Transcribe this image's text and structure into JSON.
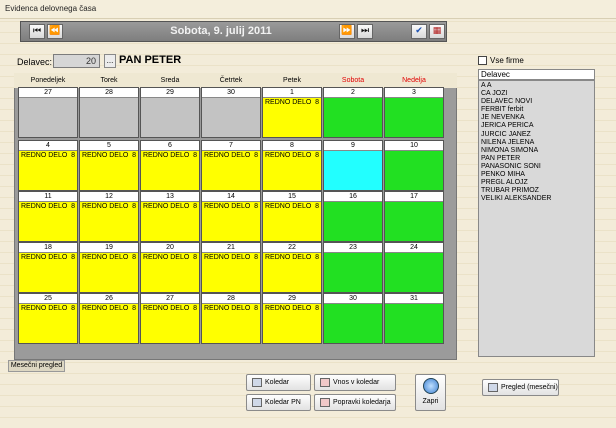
{
  "window": {
    "title": "Evidenca delovnega časa"
  },
  "nav": {
    "date_title": "Sobota,  9. julij 2011",
    "first_icon": "skip-first-icon",
    "prev_icon": "rewind-icon",
    "next_icon": "fast-forward-icon",
    "last_icon": "skip-last-icon",
    "check_icon": "check-icon",
    "calendar_icon": "calendar-icon"
  },
  "delavec": {
    "label": "Delavec:",
    "value": "20",
    "browse_label": "...",
    "name": "PAN PETER"
  },
  "days": [
    "Ponedeljek",
    "Torek",
    "Sreda",
    "Četrtek",
    "Petek",
    "Sobota",
    "Nedelja"
  ],
  "colors": {
    "work": "#ffff00",
    "weekend": "#22e022",
    "selected": "#22ffff",
    "outside": "#c3c3c3",
    "weekend_header": "#e00000"
  },
  "weeks": [
    [
      {
        "num": "27",
        "type": "outside",
        "label": "",
        "hours": ""
      },
      {
        "num": "28",
        "type": "outside",
        "label": "",
        "hours": ""
      },
      {
        "num": "29",
        "type": "outside",
        "label": "",
        "hours": ""
      },
      {
        "num": "30",
        "type": "outside",
        "label": "",
        "hours": ""
      },
      {
        "num": "1",
        "type": "work",
        "label": "REDNO DELO",
        "hours": "8"
      },
      {
        "num": "2",
        "type": "weekend",
        "label": "",
        "hours": ""
      },
      {
        "num": "3",
        "type": "weekend",
        "label": "",
        "hours": ""
      }
    ],
    [
      {
        "num": "4",
        "type": "work",
        "label": "REDNO DELO",
        "hours": "8"
      },
      {
        "num": "5",
        "type": "work",
        "label": "REDNO DELO",
        "hours": "8"
      },
      {
        "num": "6",
        "type": "work",
        "label": "REDNO DELO",
        "hours": "8"
      },
      {
        "num": "7",
        "type": "work",
        "label": "REDNO DELO",
        "hours": "8"
      },
      {
        "num": "8",
        "type": "work",
        "label": "REDNO DELO",
        "hours": "8"
      },
      {
        "num": "9",
        "type": "selected",
        "label": "",
        "hours": ""
      },
      {
        "num": "10",
        "type": "weekend",
        "label": "",
        "hours": ""
      }
    ],
    [
      {
        "num": "11",
        "type": "work",
        "label": "REDNO DELO",
        "hours": "8"
      },
      {
        "num": "12",
        "type": "work",
        "label": "REDNO DELO",
        "hours": "8"
      },
      {
        "num": "13",
        "type": "work",
        "label": "REDNO DELO",
        "hours": "8"
      },
      {
        "num": "14",
        "type": "work",
        "label": "REDNO DELO",
        "hours": "8"
      },
      {
        "num": "15",
        "type": "work",
        "label": "REDNO DELO",
        "hours": "8"
      },
      {
        "num": "16",
        "type": "weekend",
        "label": "",
        "hours": ""
      },
      {
        "num": "17",
        "type": "weekend",
        "label": "",
        "hours": ""
      }
    ],
    [
      {
        "num": "18",
        "type": "work",
        "label": "REDNO DELO",
        "hours": "8"
      },
      {
        "num": "19",
        "type": "work",
        "label": "REDNO DELO",
        "hours": "8"
      },
      {
        "num": "20",
        "type": "work",
        "label": "REDNO DELO",
        "hours": "8"
      },
      {
        "num": "21",
        "type": "work",
        "label": "REDNO DELO",
        "hours": "8"
      },
      {
        "num": "22",
        "type": "work",
        "label": "REDNO DELO",
        "hours": "8"
      },
      {
        "num": "23",
        "type": "weekend",
        "label": "",
        "hours": ""
      },
      {
        "num": "24",
        "type": "weekend",
        "label": "",
        "hours": ""
      }
    ],
    [
      {
        "num": "25",
        "type": "work",
        "label": "REDNO DELO",
        "hours": "8"
      },
      {
        "num": "26",
        "type": "work",
        "label": "REDNO DELO",
        "hours": "8"
      },
      {
        "num": "27",
        "type": "work",
        "label": "REDNO DELO",
        "hours": "8"
      },
      {
        "num": "28",
        "type": "work",
        "label": "REDNO DELO",
        "hours": "8"
      },
      {
        "num": "29",
        "type": "work",
        "label": "REDNO DELO",
        "hours": "8"
      },
      {
        "num": "30",
        "type": "weekend",
        "label": "",
        "hours": ""
      },
      {
        "num": "31",
        "type": "weekend",
        "label": "",
        "hours": ""
      }
    ]
  ],
  "tab": {
    "label": "Mesečni pregled"
  },
  "firme": {
    "label": "Vse firme"
  },
  "employees": {
    "header": "Delavec",
    "items": [
      "A A",
      "CA JOZI",
      "DELAVEC NOVI",
      "FERBIT ferbit",
      "JE NEVENKA",
      "JERICA PERICA",
      "JURCIC JANEZ",
      "NILENA JELENA",
      "NIMONA SIMONA",
      "PAN PETER",
      "PANASONIC SONI",
      "PENKO MIHA",
      "PREGL ALOJZ",
      "TRUBAR PRIMOZ",
      "VELIKI ALEKSANDER"
    ]
  },
  "buttons": {
    "koledar": "Koledar",
    "koledar_pn": "Koledar PN",
    "vnos": "Vnos v koledar",
    "popravki": "Popravki koledarja",
    "zapri": "Zapri",
    "pregled": "Pregled (mesečni)"
  }
}
